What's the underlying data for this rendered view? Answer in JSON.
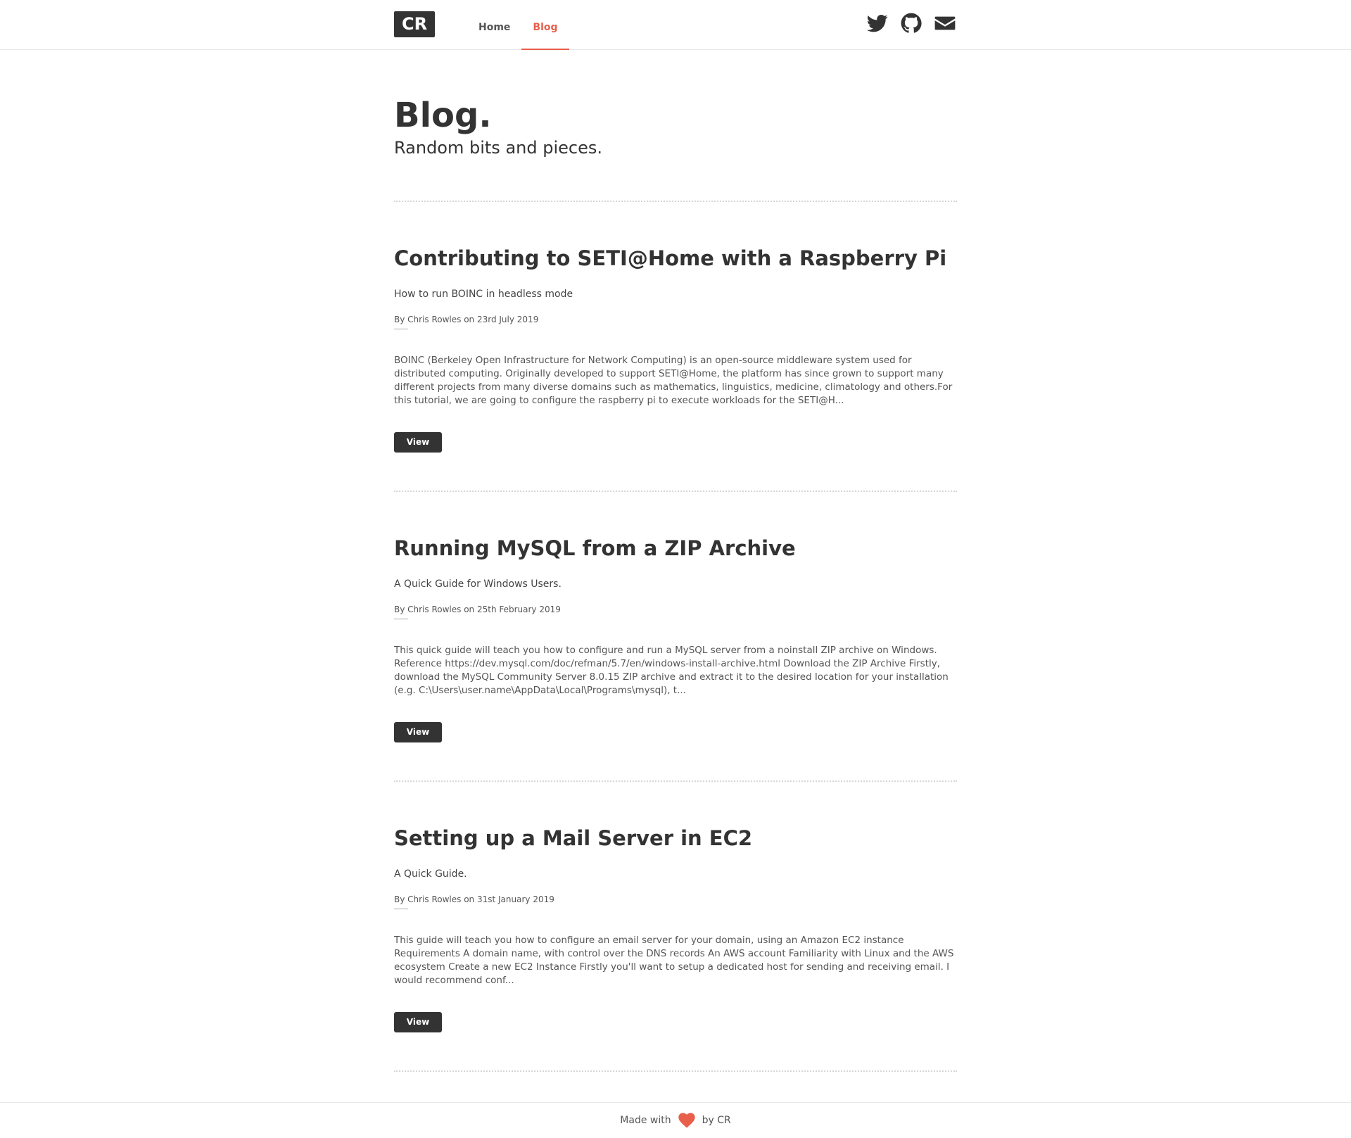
{
  "header": {
    "logo": "CR",
    "nav": [
      {
        "label": "Home",
        "active": false
      },
      {
        "label": "Blog",
        "active": true
      }
    ],
    "social": [
      "twitter-icon",
      "github-icon",
      "envelope-icon"
    ],
    "accent_color": "#e8604c"
  },
  "page": {
    "title": "Blog.",
    "subtitle": "Random bits and pieces."
  },
  "posts": [
    {
      "title": "Contributing to SETI@Home with a Raspberry Pi",
      "summary": "How to run BOINC in headless mode",
      "meta": "By Chris Rowles on 23rd July 2019",
      "excerpt": "BOINC (Berkeley Open Infrastructure for Network Computing) is an open-source middleware system used for distributed computing. Originally developed to support SETI@Home, the platform has since grown to support many different projects from many diverse domains such as mathematics, linguistics, medicine, climatology and others.For this tutorial, we are going to configure the raspberry pi to execute workloads for the SETI@H...",
      "button": "View"
    },
    {
      "title": "Running MySQL from a ZIP Archive",
      "summary": "A Quick Guide for Windows Users.",
      "meta": "By Chris Rowles on 25th February 2019",
      "excerpt": "This quick guide will teach you how to configure and run a MySQL server from a noinstall ZIP archive on Windows. Reference https://dev.mysql.com/doc/refman/5.7/en/windows-install-archive.html Download the ZIP Archive Firstly, download the MySQL Community Server 8.0.15 ZIP archive and extract it to the desired location for your installation (e.g. C:\\Users\\user.name\\AppData\\Local\\Programs\\mysql), t...",
      "button": "View"
    },
    {
      "title": "Setting up a Mail Server in EC2",
      "summary": "A Quick Guide.",
      "meta": "By Chris Rowles on 31st January 2019",
      "excerpt": "This guide will teach you how to configure an email server for your domain, using an Amazon EC2 instance Requirements A domain name, with control over the DNS records An AWS account Familiarity with Linux and the AWS ecosystem Create a new EC2 Instance Firstly you'll want to setup a dedicated host for sending and receiving email. I would recommend conf...",
      "button": "View"
    }
  ],
  "footer": {
    "made_with": "Made with",
    "by": "by CR",
    "heart_color": "#e8604c"
  }
}
